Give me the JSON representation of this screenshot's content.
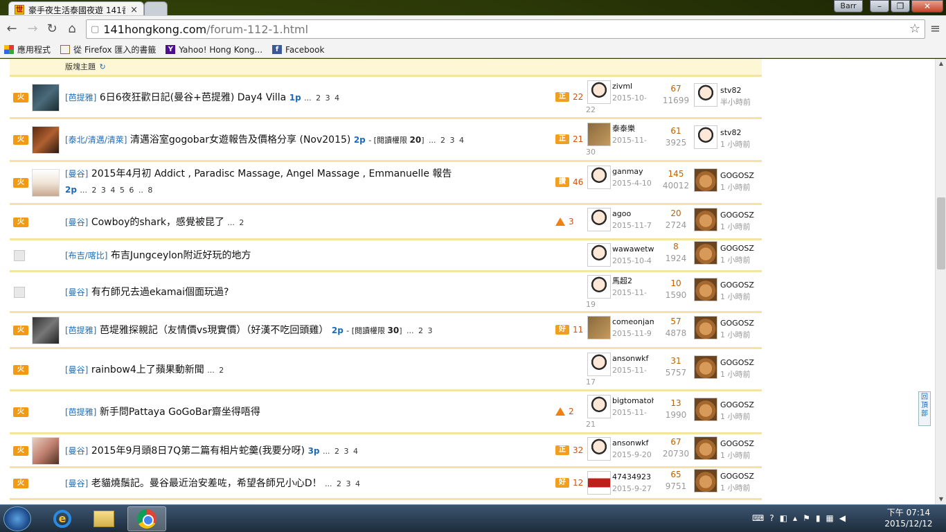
{
  "browser": {
    "active_tab_title": "豪手夜生活泰國夜遊 141香",
    "profile": "Barr",
    "url_host": "141hongkong.com",
    "url_path": "/forum-112-1.html"
  },
  "bookmarks": [
    {
      "label": "應用程式",
      "icon": "apps-grid-icon"
    },
    {
      "label": "從 Firefox 匯入的書籤",
      "icon": "folder-icon"
    },
    {
      "label": "Yahoo! Hong Kong...",
      "icon": "yahoo-icon"
    },
    {
      "label": "Facebook",
      "icon": "facebook-icon"
    }
  ],
  "forum": {
    "section_label": "版塊主題",
    "back_to_top": "回頂部",
    "rows": [
      {
        "icon": "hot",
        "cat": "[芭提雅]",
        "title": "6日6夜狂歡日記(曼谷+芭提雅) Day4 Villa",
        "pg": "1p",
        "perm_label": "",
        "perm_val": "",
        "pages": "... 2 3 4",
        "badge": "正",
        "count": "22",
        "author": "zivml",
        "date": "2015-10-22",
        "replies": "67",
        "views": "11699",
        "last_user": "stv82",
        "last_time": "半小時前"
      },
      {
        "icon": "hot",
        "cat": "[泰北/清邁/清萊]",
        "title": "清邁浴室gogobar女遊報告及價格分享 (Nov2015)",
        "pg": "2p",
        "perm_label": "- [閱讀權限 ",
        "perm_val": "20",
        "pages": "] ... 2 3 4",
        "badge": "正",
        "count": "21",
        "author": "泰泰樂",
        "date": "2015-11-30",
        "replies": "61",
        "views": "3925",
        "last_user": "stv82",
        "last_time": "1 小時前"
      },
      {
        "icon": "hot",
        "cat": "[曼谷]",
        "title": "2015年4月初 Addict , Paradisc Massage, Angel Massage , Emmanuelle 報告",
        "pg": "2p",
        "perm_label": "",
        "perm_val": "",
        "pages": "... 2 3 4 5 6 .. 8",
        "badge": "讚",
        "count": "46",
        "author": "ganmay",
        "date": "2015-4-10",
        "replies": "145",
        "views": "40012",
        "last_user": "GOGOSZ",
        "last_time": "1 小時前"
      },
      {
        "icon": "hot",
        "cat": "[曼谷]",
        "title": "Cowboy的shark，感覺被昆了",
        "pg": "",
        "perm_label": "",
        "perm_val": "",
        "pages": "... 2",
        "badge": "up",
        "count": "3",
        "author": "agoo",
        "date": "2015-11-7",
        "replies": "20",
        "views": "2724",
        "last_user": "GOGOSZ",
        "last_time": "1 小時前"
      },
      {
        "icon": "doc",
        "cat": "[布吉/喀比]",
        "title": "布吉Jungceylon附近好玩的地方",
        "pg": "",
        "perm_label": "",
        "perm_val": "",
        "pages": "",
        "badge": "",
        "count": "",
        "author": "wawawetw",
        "date": "2015-10-4",
        "replies": "8",
        "views": "1924",
        "last_user": "GOGOSZ",
        "last_time": "1 小時前"
      },
      {
        "icon": "doc",
        "cat": "[曼谷]",
        "title": "有冇師兄去過ekamai個面玩過?",
        "pg": "",
        "perm_label": "",
        "perm_val": "",
        "pages": "",
        "badge": "",
        "count": "",
        "author": "馬超2",
        "date": "2015-11-19",
        "replies": "10",
        "views": "1590",
        "last_user": "GOGOSZ",
        "last_time": "1 小時前"
      },
      {
        "icon": "hot",
        "cat": "[芭提雅]",
        "title": "芭堤雅探親記（友情價vs現實價）（好漢不吃回頭雞）",
        "pg": "2p",
        "perm_label": "- [閱讀權限 ",
        "perm_val": "30",
        "pages": "] ... 2 3",
        "badge": "好",
        "count": "11",
        "author": "comeonjam",
        "date": "2015-11-9",
        "replies": "57",
        "views": "4878",
        "last_user": "GOGOSZ",
        "last_time": "1 小時前"
      },
      {
        "icon": "hot",
        "cat": "[曼谷]",
        "title": "rainbow4上了蘋果動新聞",
        "pg": "",
        "perm_label": "",
        "perm_val": "",
        "pages": "... 2",
        "badge": "",
        "count": "",
        "author": "ansonwkf",
        "date": "2015-11-17",
        "replies": "31",
        "views": "5757",
        "last_user": "GOGOSZ",
        "last_time": "1 小時前"
      },
      {
        "icon": "hot",
        "cat": "[芭提雅]",
        "title": "新手問Pattaya GoGoBar齋坐得唔得",
        "pg": "",
        "perm_label": "",
        "perm_val": "",
        "pages": "",
        "badge": "up",
        "count": "2",
        "author": "bigtomatoh",
        "date": "2015-11-21",
        "replies": "13",
        "views": "1990",
        "last_user": "GOGOSZ",
        "last_time": "1 小時前"
      },
      {
        "icon": "hot",
        "cat": "[曼谷]",
        "title": "2015年9月頭8日7Q第二篇有相片蛇羹(我要分呀)",
        "pg": "3p",
        "perm_label": "",
        "perm_val": "",
        "pages": "... 2 3 4",
        "badge": "正",
        "count": "32",
        "author": "ansonwkf",
        "date": "2015-9-20",
        "replies": "67",
        "views": "20730",
        "last_user": "GOGOSZ",
        "last_time": "1 小時前"
      },
      {
        "icon": "hot",
        "cat": "[曼谷]",
        "title": "老貓燒鬚記。曼谷最近治安差咗，希望各師兄小心D！",
        "pg": "",
        "perm_label": "",
        "perm_val": "",
        "pages": "... 2 3 4",
        "badge": "好",
        "count": "12",
        "author": "47434923",
        "date": "2015-9-27",
        "replies": "65",
        "views": "9751",
        "last_user": "GOGOSZ",
        "last_time": "1 小時前"
      }
    ]
  },
  "taskbar": {
    "clock_time": "下午 07:14",
    "clock_date": "2015/12/12"
  }
}
